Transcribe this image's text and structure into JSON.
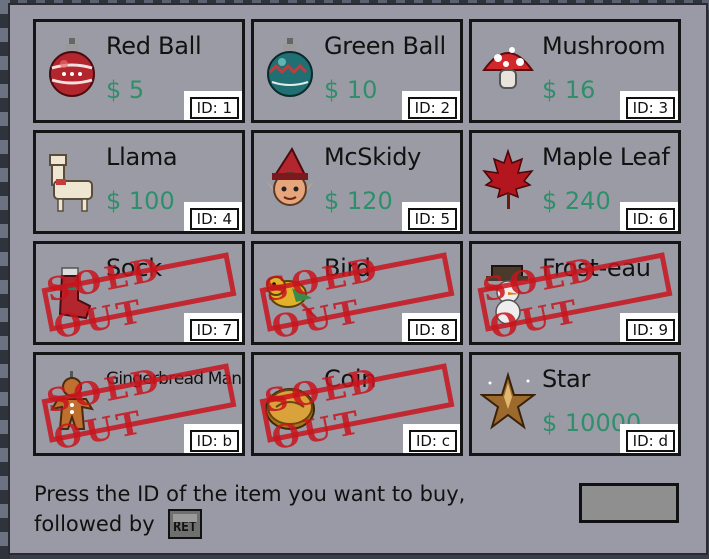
{
  "shop": {
    "items": [
      {
        "name": "Red Ball",
        "price": "$ 5",
        "id": "ID: 1",
        "sold_out": false,
        "icon": "red-ornament-icon"
      },
      {
        "name": "Green Ball",
        "price": "$ 10",
        "id": "ID: 2",
        "sold_out": false,
        "icon": "green-ornament-icon"
      },
      {
        "name": "Mushroom",
        "price": "$ 16",
        "id": "ID: 3",
        "sold_out": false,
        "icon": "mushroom-icon"
      },
      {
        "name": "Llama",
        "price": "$ 100",
        "id": "ID: 4",
        "sold_out": false,
        "icon": "llama-icon"
      },
      {
        "name": "McSkidy",
        "price": "$ 120",
        "id": "ID: 5",
        "sold_out": false,
        "icon": "elf-icon"
      },
      {
        "name": "Maple Leaf",
        "price": "$ 240",
        "id": "ID: 6",
        "sold_out": false,
        "icon": "maple-leaf-icon"
      },
      {
        "name": "Sock",
        "price": "",
        "id": "ID: 7",
        "sold_out": true,
        "icon": "sock-icon"
      },
      {
        "name": "Bird",
        "price": "",
        "id": "ID: 8",
        "sold_out": true,
        "icon": "bird-icon"
      },
      {
        "name": "Frost-eau",
        "price": "",
        "id": "ID: 9",
        "sold_out": true,
        "icon": "snowman-icon"
      },
      {
        "name": "Gingerbread Man",
        "price": "",
        "id": "ID: b",
        "sold_out": true,
        "icon": "gingerbread-icon"
      },
      {
        "name": "Coin",
        "price": "",
        "id": "ID: c",
        "sold_out": true,
        "icon": "coin-icon"
      },
      {
        "name": "Star",
        "price": "$ 10000",
        "id": "ID: d",
        "sold_out": false,
        "icon": "star-icon"
      }
    ],
    "sold_out_label": "SOLD OUT",
    "prompt_line1": "Press the ID of the item you want to buy,",
    "prompt_line2": "followed by",
    "enter_key_label": "RET",
    "input_value": ""
  }
}
